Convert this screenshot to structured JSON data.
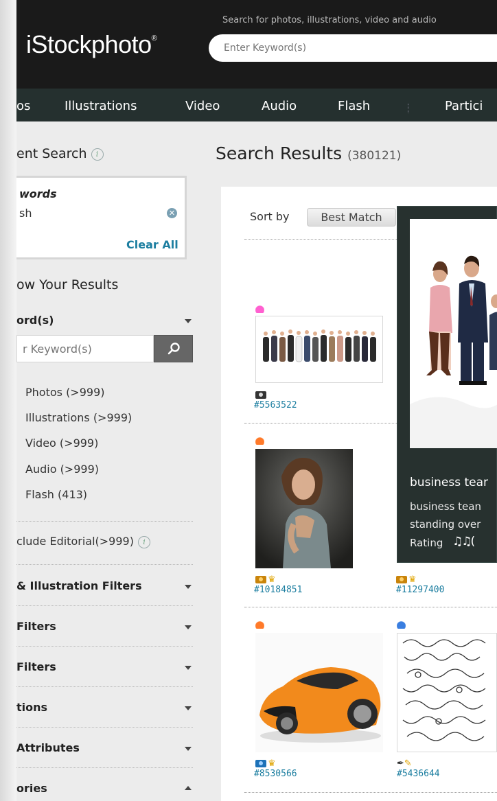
{
  "header": {
    "logo": "iStockphoto",
    "logo_mark": "®",
    "search_hint": "Search for photos, illustrations, video and audio",
    "search_placeholder": "Enter Keyword(s)"
  },
  "nav": {
    "items": [
      {
        "label": "os"
      },
      {
        "label": "Illustrations"
      },
      {
        "label": "Video"
      },
      {
        "label": "Audio"
      },
      {
        "label": "Flash"
      },
      {
        "label": "Partici"
      }
    ]
  },
  "sidebar": {
    "current_search_label": "ent Search",
    "keywords_title": "words",
    "keyword_value": "sh",
    "clear_all": "Clear All",
    "narrow_label": "ow Your Results",
    "keyword_section": "ord(s)",
    "refine_placeholder": "r Keyword(s)",
    "types": [
      {
        "label": "Photos  (>999)"
      },
      {
        "label": "Illustrations  (>999)"
      },
      {
        "label": "Video  (>999)"
      },
      {
        "label": "Audio  (>999)"
      },
      {
        "label": "Flash  (413)"
      }
    ],
    "editorial": "clude Editorial(>999)",
    "filters": [
      {
        "label": "& Illustration Filters"
      },
      {
        "label": "Filters"
      },
      {
        "label": "Filters"
      },
      {
        "label": "tions"
      },
      {
        "label": "Attributes"
      },
      {
        "label": "ories"
      }
    ]
  },
  "results": {
    "title": "Search Results",
    "count": "(380121)",
    "sort_label": "Sort by",
    "sort_value": "Best Match",
    "items": [
      {
        "id": "#5563522"
      },
      {
        "id": "#10184851"
      },
      {
        "id": "#11297400"
      },
      {
        "id": "#8530566"
      },
      {
        "id": "#5436644"
      }
    ]
  },
  "popup": {
    "title": "business tear",
    "desc_line1": "business tean",
    "desc_line2": "standing over",
    "rating_label": "Rating",
    "rating_notes": "♫♫("
  },
  "colors": {
    "header_bg": "#1a1a1a",
    "nav_bg": "#25302f",
    "link": "#1c7ea0",
    "popup_bg": "#27312f"
  }
}
